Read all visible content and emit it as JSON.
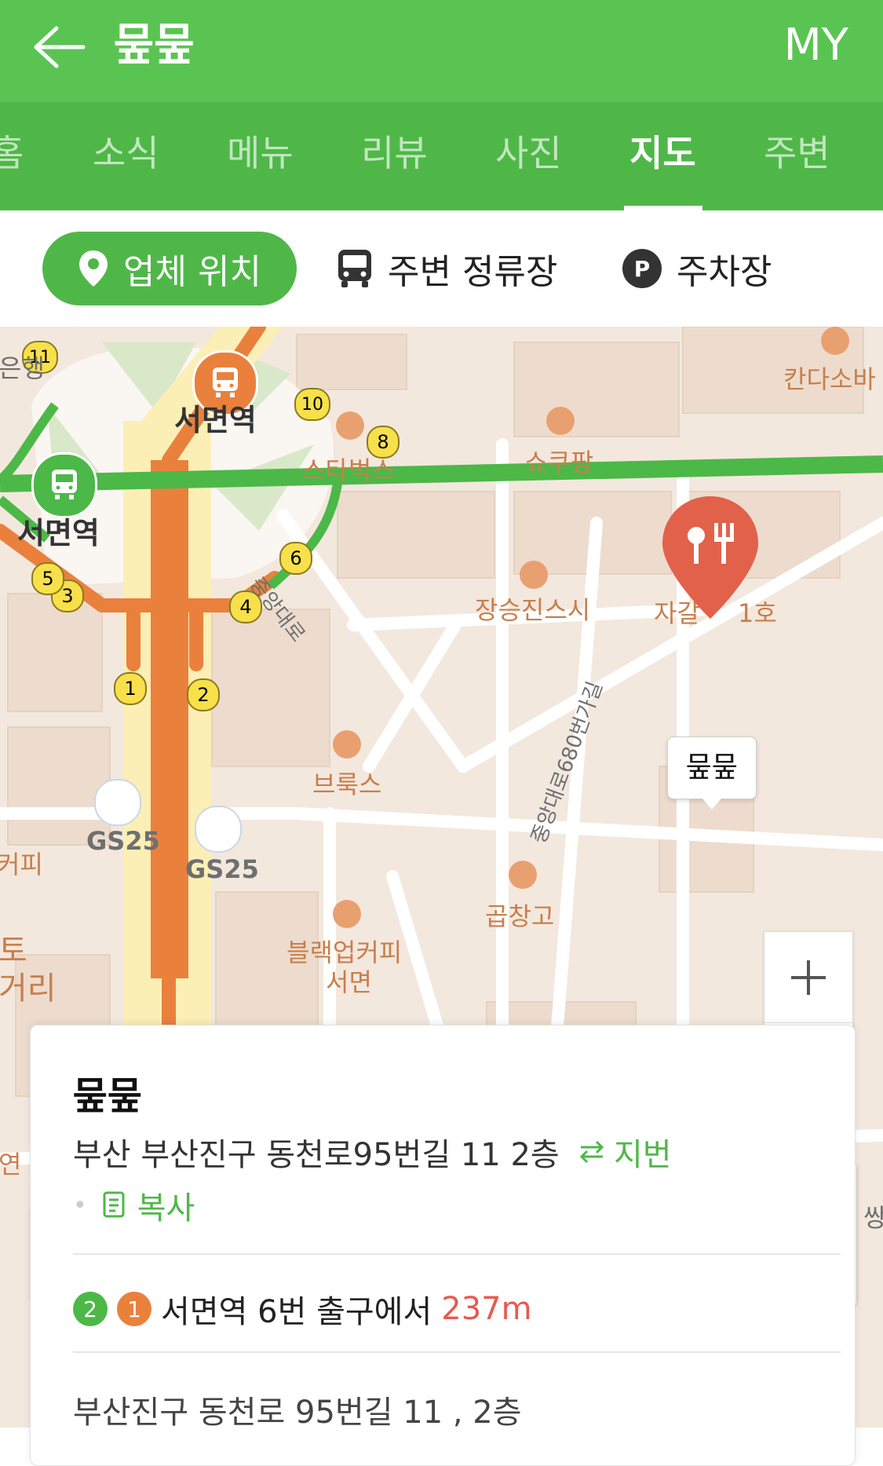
{
  "header": {
    "title": "뭎뭎",
    "my_label": "MY"
  },
  "tabs": [
    {
      "label": "홈"
    },
    {
      "label": "소식"
    },
    {
      "label": "메뉴"
    },
    {
      "label": "리뷰"
    },
    {
      "label": "사진"
    },
    {
      "label": "지도",
      "active": true
    },
    {
      "label": "주변"
    }
  ],
  "filters": {
    "location": "업체 위치",
    "bus": "주변 정류장",
    "parking": "주차장",
    "parking_icon_letter": "P"
  },
  "map": {
    "callout": "뭎뭎",
    "station_labels": [
      "서면역",
      "서면역"
    ],
    "poi": {
      "starbucks": "스타벅스",
      "shokupang": "쇼쿠팡",
      "kandasoba": "칸다소바",
      "jangseungjin": "장승진스시",
      "jagal": "자갈",
      "jagal_suffix": "1호",
      "brooks": "브룩스",
      "gopchang": "곱창고",
      "blackup": "블랙업커피",
      "blackup_sub": "서면",
      "gs25_a": "GS25",
      "gs25_b": "GS25",
      "bank": "은행",
      "coffee": "커피",
      "left_to": "토",
      "left_geori": "거리",
      "left_yeon": "연",
      "right_ssang": "쌍"
    },
    "roads": {
      "jungangdaero": "중앙대로",
      "jungangdaero680": "중앙대로680번가길"
    },
    "exits": [
      "1",
      "2",
      "3",
      "4",
      "5",
      "6",
      "8",
      "10",
      "11"
    ],
    "zoom_in": "+",
    "zoom_out": "−"
  },
  "card": {
    "name": "뭎뭎",
    "address": "부산 부산진구 동천로95번길 11 2층",
    "jibun": "지번",
    "copy": "복사",
    "transit": {
      "line2": "2",
      "line1": "1",
      "text": "서면역 6번 출구에서",
      "distance": "237m"
    },
    "address2": "부산진구 동천로 95번길 11 , 2층"
  },
  "colors": {
    "header": "#5AC452",
    "tabs": "#4FB748",
    "accent": "#4FB748",
    "pin": "#E2614A",
    "distance": "#E85A4F"
  }
}
